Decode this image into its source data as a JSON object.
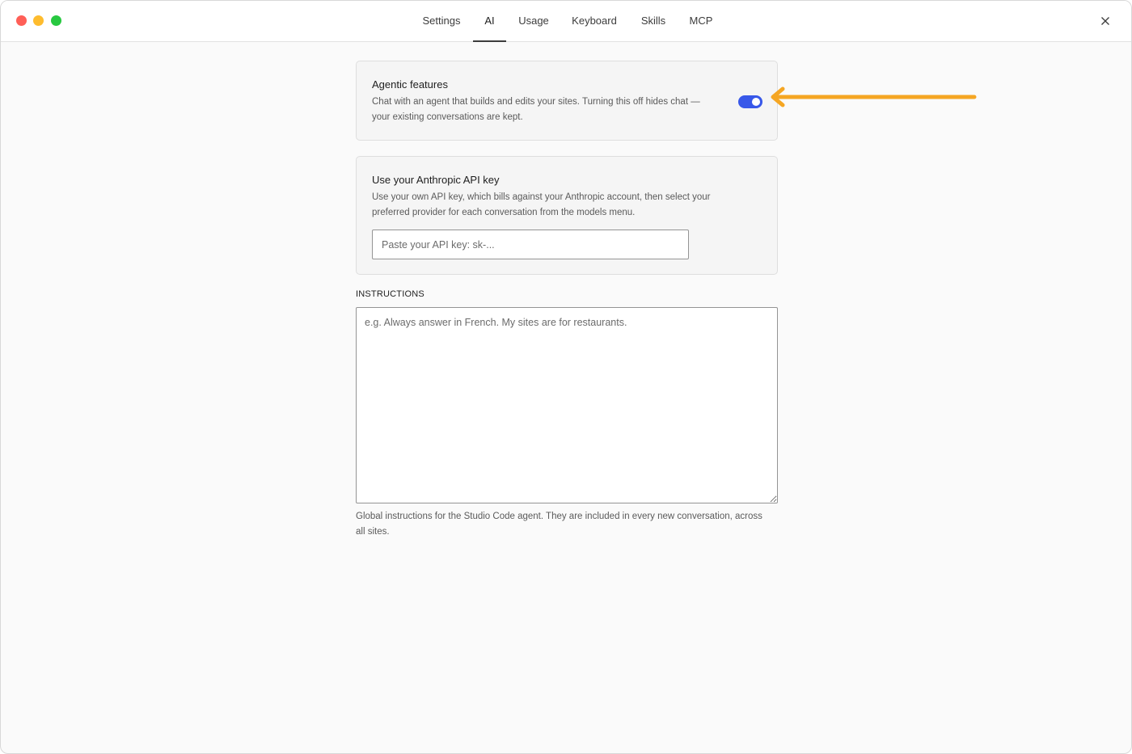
{
  "colors": {
    "traffic_red": "#ff5f57",
    "traffic_yellow": "#febc2e",
    "traffic_green": "#28c840",
    "toggle_on": "#3858e9",
    "annotation_arrow": "#f5a623"
  },
  "window": {
    "close_icon": "close-icon"
  },
  "tabs": [
    {
      "label": "Settings",
      "active": false
    },
    {
      "label": "AI",
      "active": true
    },
    {
      "label": "Usage",
      "active": false
    },
    {
      "label": "Keyboard",
      "active": false
    },
    {
      "label": "Skills",
      "active": false
    },
    {
      "label": "MCP",
      "active": false
    }
  ],
  "agentic": {
    "title": "Agentic features",
    "description_line1": "Chat with an agent that builds and edits your sites. Turning this off hides chat —",
    "description_line2": "your existing conversations are kept.",
    "toggle_on": true
  },
  "api_key": {
    "title": "Use your Anthropic API key",
    "description_line1": "Use your own API key, which bills against your Anthropic account, then select your",
    "description_line2": "preferred provider for each conversation from the models menu.",
    "input_value": "",
    "input_placeholder": "Paste your API key: sk-..."
  },
  "instructions": {
    "label": "INSTRUCTIONS",
    "value": "",
    "placeholder": "e.g. Always answer in French. My sites are for restaurants.",
    "help_line1": "Global instructions for the Studio Code agent. They are included in every new conversation, across",
    "help_line2": "all sites."
  },
  "annotation": {
    "icon": "arrow-left-icon"
  }
}
